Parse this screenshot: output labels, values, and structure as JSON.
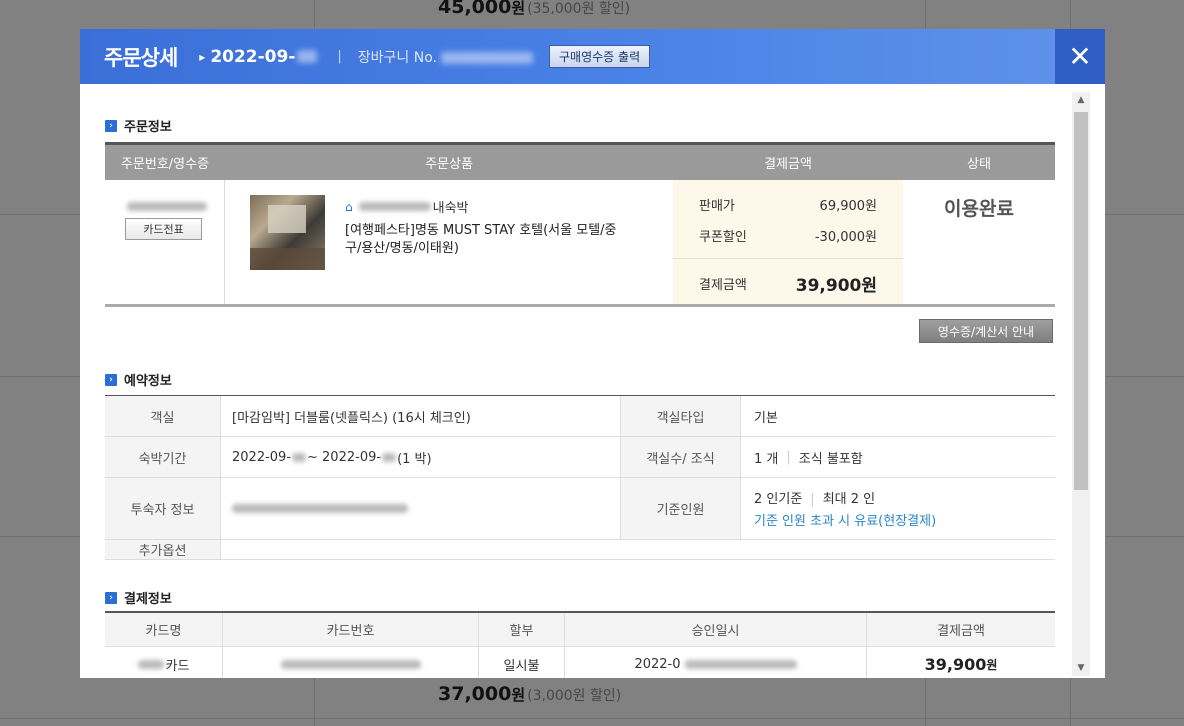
{
  "background": {
    "top_price": "45,000",
    "top_unit": "원",
    "top_discount": "(35,000원 할인)",
    "bottom_price": "37,000",
    "bottom_unit": "원",
    "bottom_discount": "(3,000원 할인)"
  },
  "header": {
    "title": "주문상세",
    "date_prefix": "2022-09-",
    "separator": "|",
    "cart_label": "장바구니 No.",
    "receipt_button": "구매영수증 출력",
    "close_label": "✕"
  },
  "order": {
    "section_title": "주문정보",
    "columns": [
      "주문번호/영수증",
      "주문상품",
      "결제금액",
      "상태"
    ],
    "card_slip_button": "카드전표",
    "category_suffix": "내숙박",
    "product_name": "[여행페스타]명동 MUST STAY 호텔(서울 모텔/중구/용산/명동/이태원)",
    "sale_price_label": "판매가",
    "sale_price": "69,900원",
    "coupon_label": "쿠폰할인",
    "coupon_value": "-30,000원",
    "total_label": "결제금액",
    "total_value": "39,900원",
    "status": "이용완료",
    "invoice_button": "영수증/계산서 안내"
  },
  "reservation": {
    "section_title": "예약정보",
    "room_label": "객실",
    "room_value": "[마감임박] 더블룸(넷플릭스) (16시 체크인)",
    "room_type_label": "객실타입",
    "room_type_value": "기본",
    "stay_label": "숙박기간",
    "stay_start": "2022-09-",
    "stay_mid": " ~ 2022-09-",
    "stay_nights": "(1 박)",
    "rooms_meal_label": "객실수/ 조식",
    "rooms_count": "1 개",
    "meal": "조식 불포함",
    "guest_label": "투숙자 정보",
    "capacity_label": "기준인원",
    "capacity_base": "2 인기준",
    "capacity_max": "최대 2 인",
    "capacity_note": "기준 인원 초과 시 유료(현장결제)",
    "extra_label": "추가옵션"
  },
  "payment": {
    "section_title": "결제정보",
    "columns": [
      "카드명",
      "카드번호",
      "할부",
      "승인일시",
      "결제금액"
    ],
    "card_name_suffix": "카드",
    "installment": "일시불",
    "approval_prefix": "2022-0",
    "amount": "39,900",
    "amount_unit": "원"
  },
  "colors": {
    "header_blue": "#3b6fd8",
    "close_blue": "#2f5fc4",
    "link_blue": "#2a86c9",
    "price_panel": "#fdf8ea"
  }
}
